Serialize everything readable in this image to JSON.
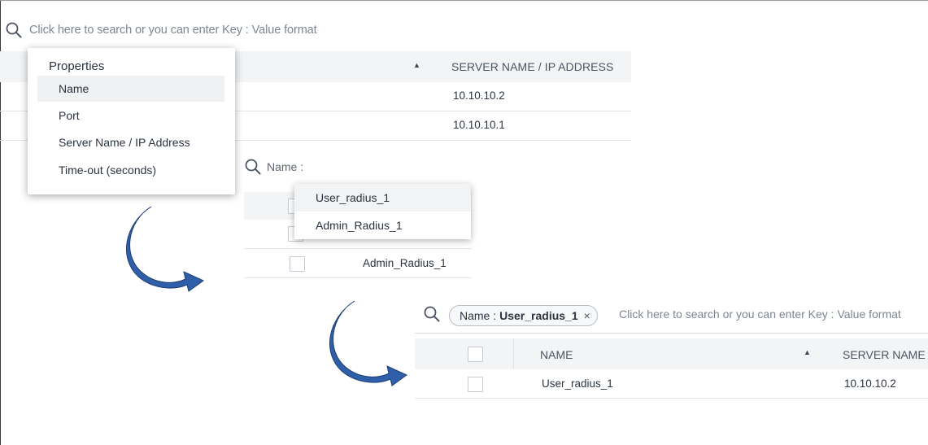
{
  "panel1": {
    "search_placeholder": "Click here to search or you can enter Key : Value format",
    "table": {
      "column_server": "SERVER NAME / IP ADDRESS",
      "rows": [
        "10.10.10.2",
        "10.10.10.1"
      ]
    },
    "properties_menu": {
      "title": "Properties",
      "items": [
        "Name",
        "Port",
        "Server Name / IP Address",
        "Time-out (seconds)"
      ]
    }
  },
  "panel2": {
    "search_label": "Name :",
    "suggestions": [
      "User_radius_1",
      "Admin_Radius_1"
    ],
    "row_value": "Admin_Radius_1"
  },
  "panel3": {
    "chip": {
      "key": "Name :",
      "value": "User_radius_1",
      "remove": "×"
    },
    "search_placeholder": "Click here to search or you can enter Key : Value format",
    "table": {
      "column_name": "NAME",
      "column_server": "SERVER NAME",
      "row": {
        "name": "User_radius_1",
        "server": "10.10.10.2"
      }
    }
  },
  "colors": {
    "arrow": "#2f5fa8",
    "header_bg": "#f2f4f6"
  },
  "icons": {
    "search": "search-icon",
    "sort": "sort-ascending-icon",
    "flow_arrow": "curved-arrow-icon"
  }
}
